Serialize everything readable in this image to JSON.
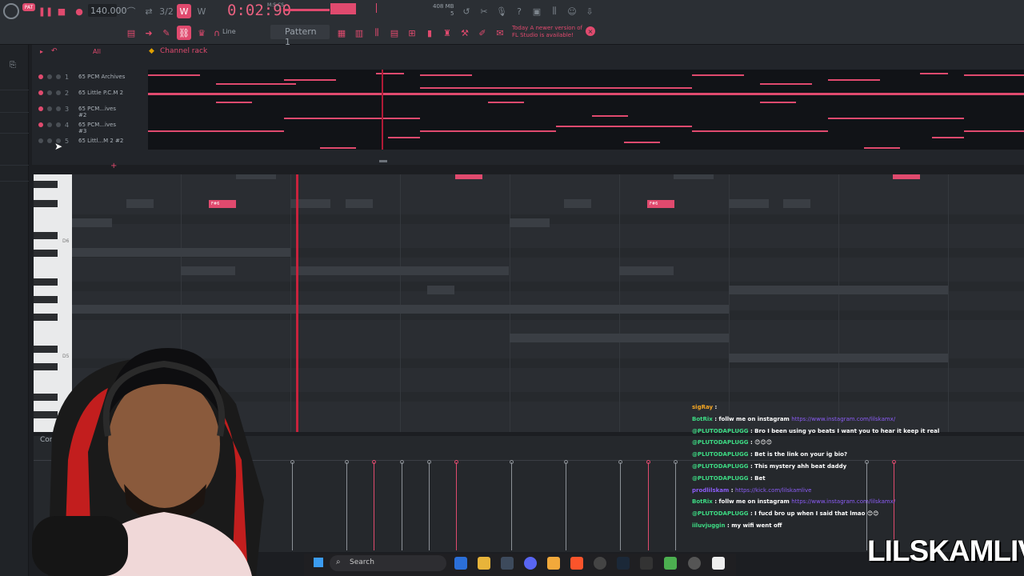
{
  "toolbar": {
    "tempo": "140.000",
    "time": "0:02:90",
    "time_unit": "M:S:CS",
    "memory_top": "408 MB",
    "memory_bottom": "5",
    "pattern": "Pattern 1",
    "snap": "Line",
    "news_line1": "Today  A newer version of",
    "news_line2": "FL Studio is available!"
  },
  "browser": {
    "filter": "All"
  },
  "channel_rack": {
    "title": "Channel rack",
    "channels": [
      {
        "num": "1",
        "name": "65 PCM Archives"
      },
      {
        "num": "2",
        "name": "65 Little P.C.M 2"
      },
      {
        "num": "3",
        "name": "65 PCM...ives #2"
      },
      {
        "num": "4",
        "name": "65 PCM...ives #3"
      },
      {
        "num": "5",
        "name": "65 Littl...M 2 #2"
      }
    ]
  },
  "piano_roll": {
    "key_label_1": "D6",
    "key_label_2": "D5",
    "note_label": "F#6",
    "control_label": "Cont"
  },
  "taskbar": {
    "search_placeholder": "Search"
  },
  "chat": {
    "messages": [
      {
        "user": "sigRay",
        "text": "",
        "link": "",
        "color": "#f5a623"
      },
      {
        "user": "BotRix",
        "text": ": follw me on instagram",
        "link": "https://www.instagram.com/lilskamx/",
        "color": "#3ddc84"
      },
      {
        "user": "@PLUTODAPLUGG",
        "text": ": Bro I been using yo beats I want you to hear it keep it real",
        "link": "",
        "color": "#3ddc84"
      },
      {
        "user": "@PLUTODAPLUGG",
        "text": ": 😊😊😊",
        "link": "",
        "color": "#3ddc84"
      },
      {
        "user": "@PLUTODAPLUGG",
        "text": ": Bet is the link on your ig bio?",
        "link": "",
        "color": "#3ddc84"
      },
      {
        "user": "@PLUTODAPLUGG",
        "text": ": This mystery ahh beat daddy",
        "link": "",
        "color": "#3ddc84"
      },
      {
        "user": "@PLUTODAPLUGG",
        "text": ": Bet",
        "link": "",
        "color": "#3ddc84"
      },
      {
        "user": "prodlilskam",
        "text": ":",
        "link": "https://kick.com/lilskamlive",
        "color": "#8b5cf6"
      },
      {
        "user": "BotRix",
        "text": ": follw me on instagram",
        "link": "https://www.instagram.com/lilskamx/",
        "color": "#3ddc84"
      },
      {
        "user": "@PLUTODAPLUGG",
        "text": ": I fucd bro up when I said that lmao 😊😊",
        "link": "",
        "color": "#3ddc84"
      },
      {
        "user": "iiluvjuggin",
        "text": ": my wifi went off",
        "link": "",
        "color": "#3ddc84"
      }
    ]
  },
  "watermark": "LILSKAMLIVE",
  "colors": {
    "accent": "#e04a6e",
    "playhead": "#c8223d",
    "panel": "#2b2f34"
  }
}
